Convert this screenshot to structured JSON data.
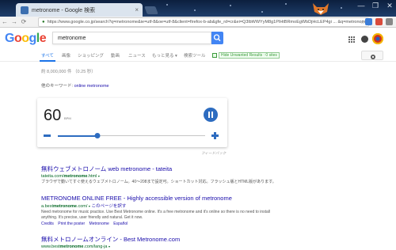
{
  "browser": {
    "tab_title": "metronome - Google 検索",
    "tab_close": "×",
    "url": "https://www.google.co.jp/search?q=metronome&ie=utf-8&oe=utf-8&client=firefox-b-ab&gfe_rd=cr&ei=Q3lbWWYyM8g1PIHtBRmoEgWbDjHcLEP4gi ... &q=metronome",
    "window_controls": [
      "—",
      "❐",
      "✕"
    ],
    "nav": {
      "back": "←",
      "forward": "→",
      "reload": "⟳"
    },
    "lock": "●",
    "star": "☆"
  },
  "google": {
    "logo_letters": [
      {
        "ch": "G",
        "color": "#4285F4"
      },
      {
        "ch": "o",
        "color": "#EA4335"
      },
      {
        "ch": "o",
        "color": "#FBBC05"
      },
      {
        "ch": "g",
        "color": "#4285F4"
      },
      {
        "ch": "l",
        "color": "#34A853"
      },
      {
        "ch": "e",
        "color": "#EA4335"
      }
    ],
    "query": "metronome",
    "tabs": [
      "すべて",
      "画像",
      "ショッピング",
      "動画",
      "ニュース",
      "もっと見る ▾",
      "検索ツール"
    ],
    "hide_unwanted": "Hide Unwanted Results : 0 sites",
    "stats": "約 8,000,000 件 （0.25 秒）",
    "related_label": "他のキーワード:",
    "related_link": "online metronome"
  },
  "metronome": {
    "bpm": "60",
    "bpm_unit": "BPM",
    "slider_fraction": 0.27,
    "minus_label": "−",
    "plus_label": "+",
    "feedback": "フィードバック"
  },
  "results": [
    {
      "title": "無料ウェブメトロノーム web metronome - tateita",
      "url_prefix": "tateita.com/",
      "url_bold": "metronome",
      "url_suffix": ".html",
      "snippet": "ブラウザで動いてすぐ使えるウェブメトロノーム。40〜208まで設定可。ショートカット対応。フラッシュ版とHTML版があります。",
      "links": []
    },
    {
      "title": "METRONOME ONLINE FREE - Highly accessible version of metronome",
      "url_prefix": "a.best",
      "url_bold": "metronome",
      "url_suffix": ".com/",
      "url_extra": "このページを訳す",
      "snippet": "Need metronome for music practice. Use Best Metronome online. It's a free metronome and it's online so there is no need to install anything. It's precise, user friendly and natural. Get it now.",
      "links": [
        "Credits",
        "Print the poster",
        "Metronome",
        "Español"
      ]
    },
    {
      "title": "無料メトロノームオンライン - Best Metronome.com",
      "url_prefix": "www.best",
      "url_bold": "metronome",
      "url_suffix": ".com/lang-ja",
      "snippet": "",
      "links": []
    }
  ],
  "colors": {
    "accent": "#2d6cc0",
    "link": "#1a0dab",
    "url_green": "#006621"
  }
}
